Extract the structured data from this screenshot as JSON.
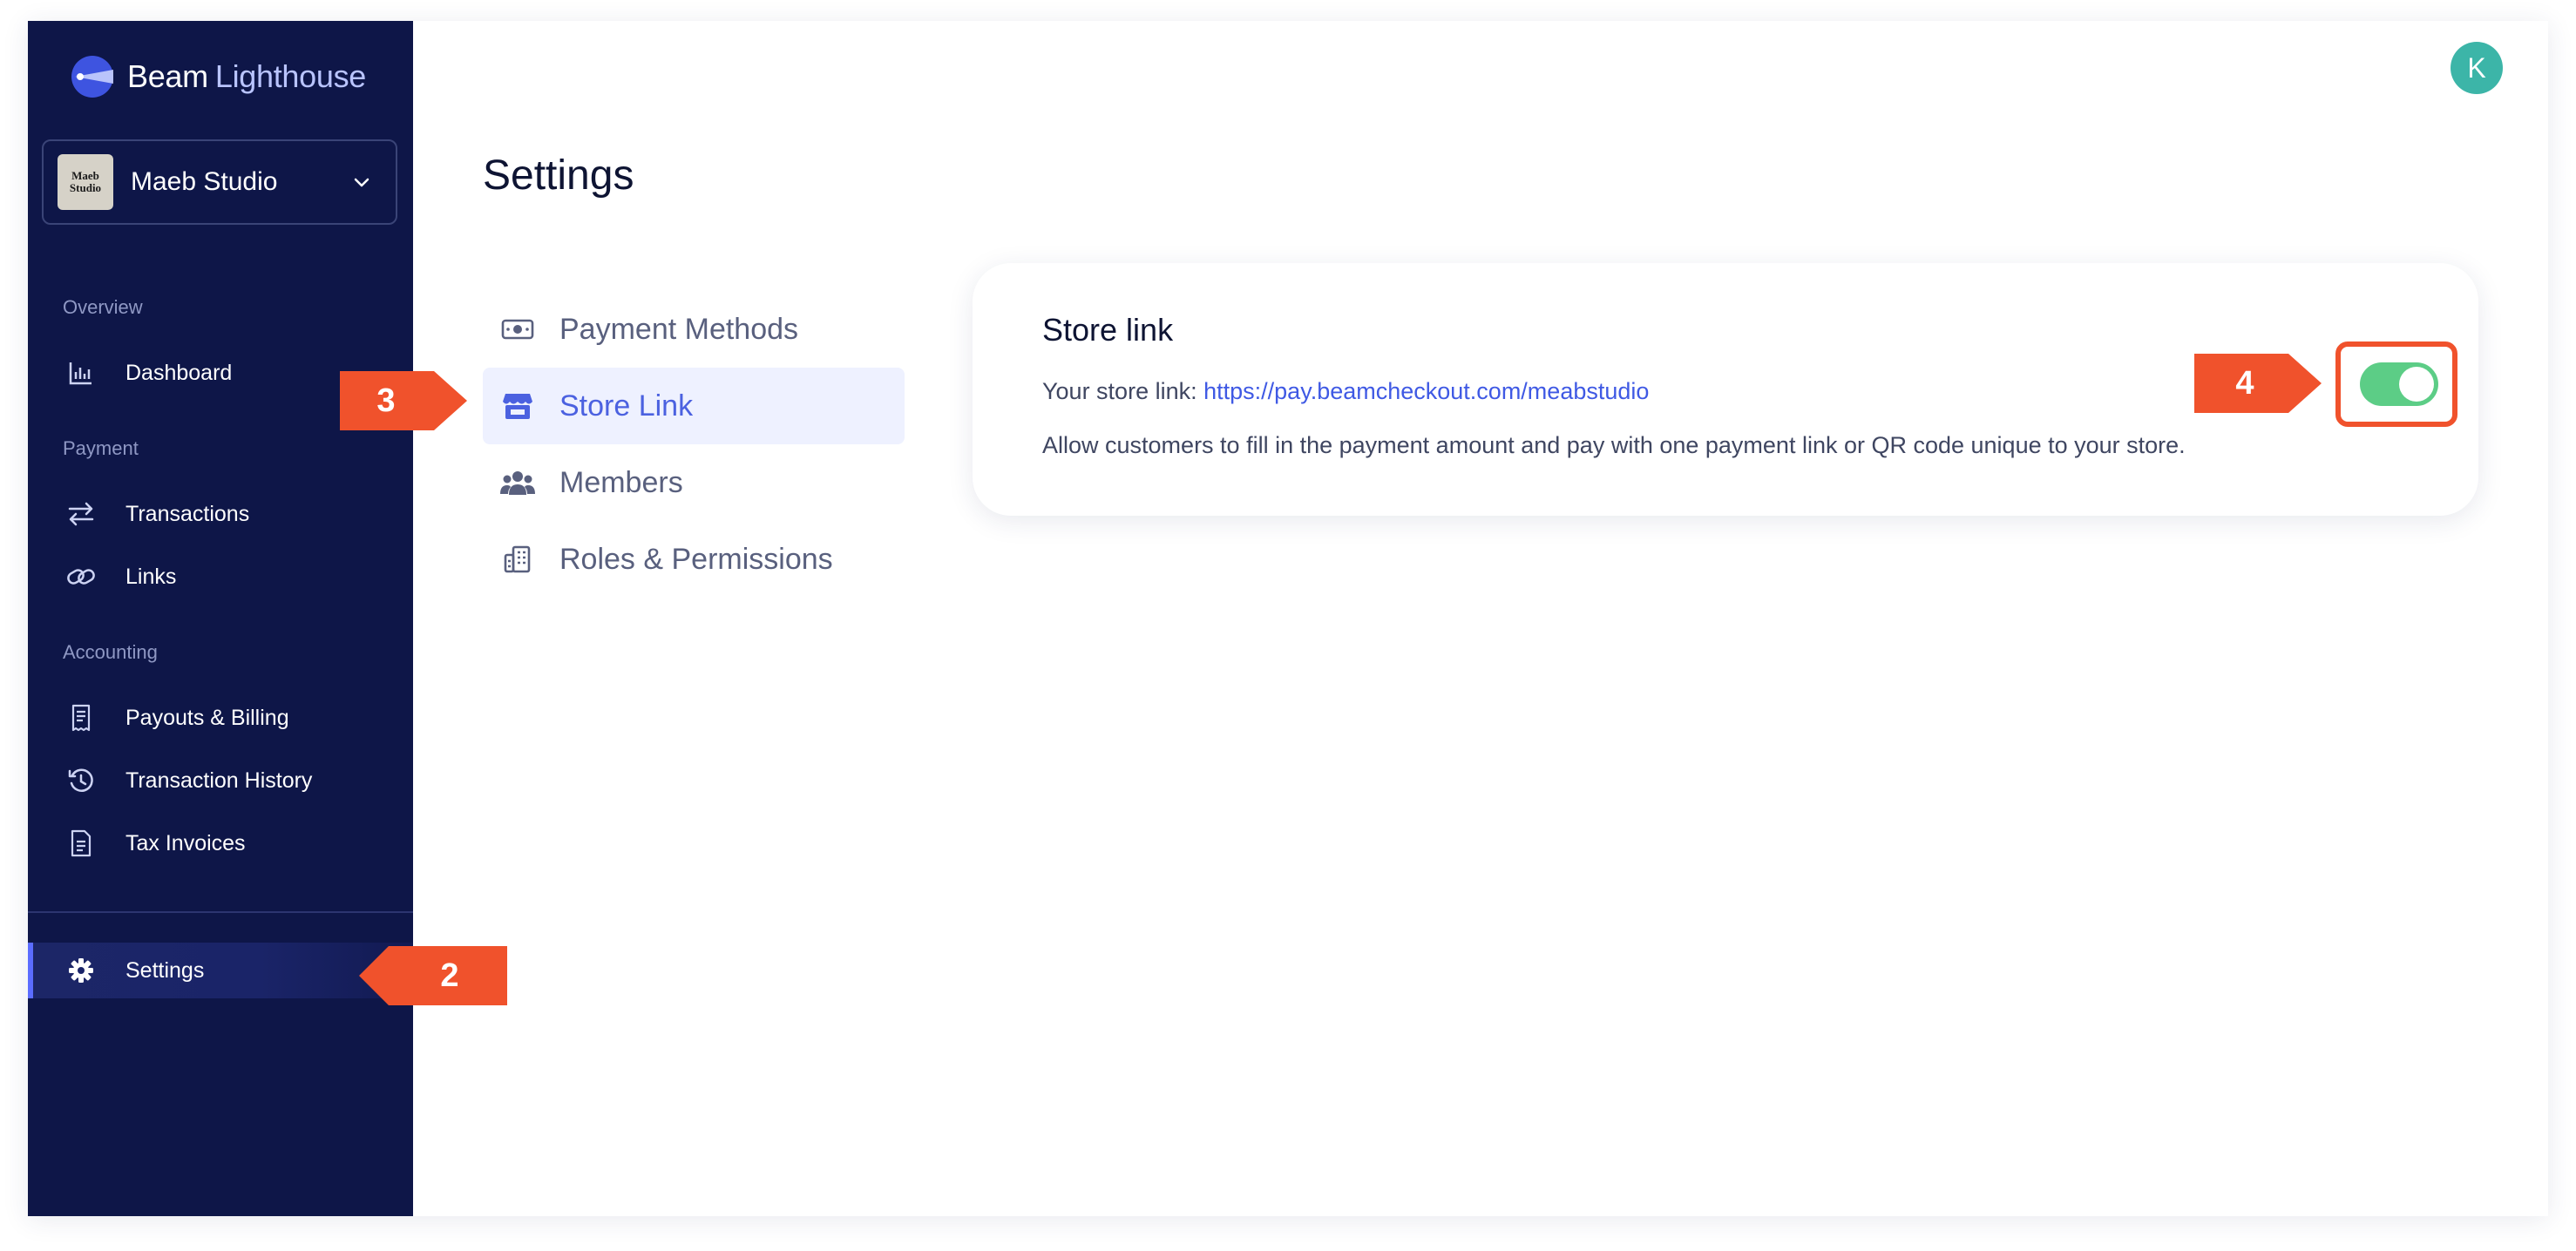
{
  "app": {
    "brand_primary": "Beam",
    "brand_secondary": "Lighthouse",
    "org_name": "Maeb Studio",
    "org_avatar_text": "Maeb Studio",
    "user_initial": "K"
  },
  "sidebar": {
    "sections": [
      {
        "label": "Overview"
      },
      {
        "label": "Payment"
      },
      {
        "label": "Accounting"
      }
    ],
    "items": [
      {
        "label": "Dashboard",
        "icon": "chart-bar-icon"
      },
      {
        "label": "Transactions",
        "icon": "arrows-swap-icon"
      },
      {
        "label": "Links",
        "icon": "link-icon"
      },
      {
        "label": "Payouts & Billing",
        "icon": "receipt-icon"
      },
      {
        "label": "Transaction History",
        "icon": "history-icon"
      },
      {
        "label": "Tax Invoices",
        "icon": "document-icon"
      },
      {
        "label": "Settings",
        "icon": "gear-icon",
        "active": true
      }
    ]
  },
  "main": {
    "title": "Settings",
    "settings_nav": [
      {
        "label": "Payment Methods",
        "icon": "cash-icon"
      },
      {
        "label": "Store Link",
        "icon": "store-icon",
        "active": true
      },
      {
        "label": "Members",
        "icon": "users-icon"
      },
      {
        "label": "Roles & Permissions",
        "icon": "building-icon"
      }
    ],
    "store_link_card": {
      "title": "Store link",
      "link_prefix": "Your store link:",
      "link_url": "https://pay.beamcheckout.com/meabstudio",
      "description": "Allow customers to fill in the payment amount and pay with one payment link or QR code unique to your store.",
      "toggle_on": true
    }
  },
  "annotations": [
    {
      "label": "2"
    },
    {
      "label": "3"
    },
    {
      "label": "4"
    }
  ],
  "colors": {
    "sidebar_bg": "#0e1648",
    "accent": "#4b61e0",
    "callout": "#f0522c",
    "toggle_on": "#5ccd86",
    "avatar": "#3cb5a8"
  }
}
